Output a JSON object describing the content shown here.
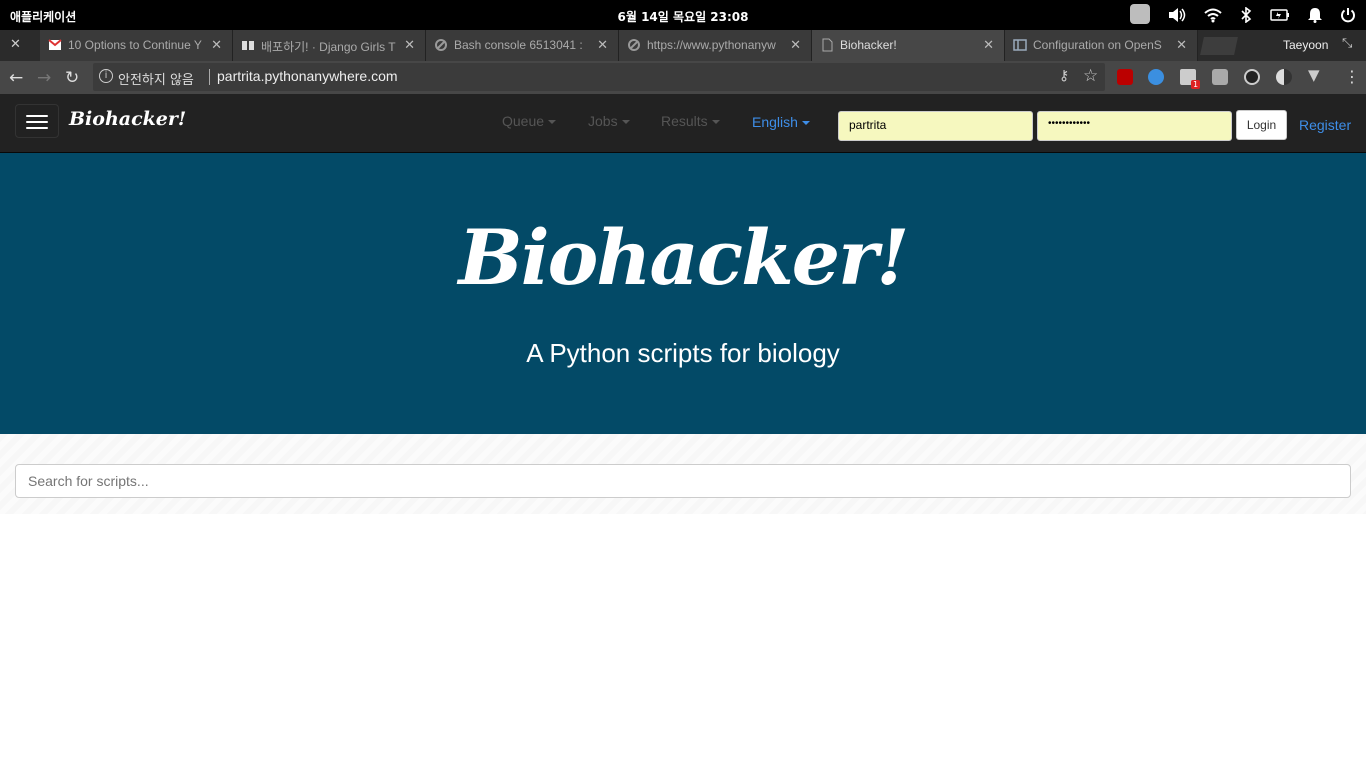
{
  "system": {
    "apps_label": "애플리케이션",
    "clock": "6월 14일 목요일   23:08"
  },
  "browser": {
    "tabs": [
      {
        "title": "10 Options to Continue Y",
        "icon": "gmail-icon"
      },
      {
        "title": "배포하기! · Django Girls T",
        "icon": "book-icon"
      },
      {
        "title": "Bash console 6513041 :",
        "icon": "pythonanywhere-icon"
      },
      {
        "title": "https://www.pythonanyw",
        "icon": "pythonanywhere-icon"
      },
      {
        "title": "Biohacker!",
        "icon": "page-icon",
        "active": true
      },
      {
        "title": "Configuration on OpenS",
        "icon": "docs-icon"
      }
    ],
    "profile": "Taeyoon",
    "security_label": "안전하지 않음",
    "url": "partrita.pythonanywhere.com",
    "extension_badge": "1"
  },
  "site": {
    "brand": "Biohacker!",
    "nav": {
      "queue": "Queue",
      "jobs": "Jobs",
      "results": "Results",
      "language": "English"
    },
    "login": {
      "username": "partrita",
      "password": "••••••••••••",
      "button": "Login",
      "register": "Register"
    },
    "hero": {
      "title": "Biohacker!",
      "subtitle": "A Python scripts for biology"
    },
    "search": {
      "placeholder": "Search for scripts..."
    }
  },
  "colors": {
    "hero_bg": "#034a67",
    "navbar_bg": "#222222",
    "link": "#3e8ee8",
    "autofill": "#f6f8bf"
  }
}
